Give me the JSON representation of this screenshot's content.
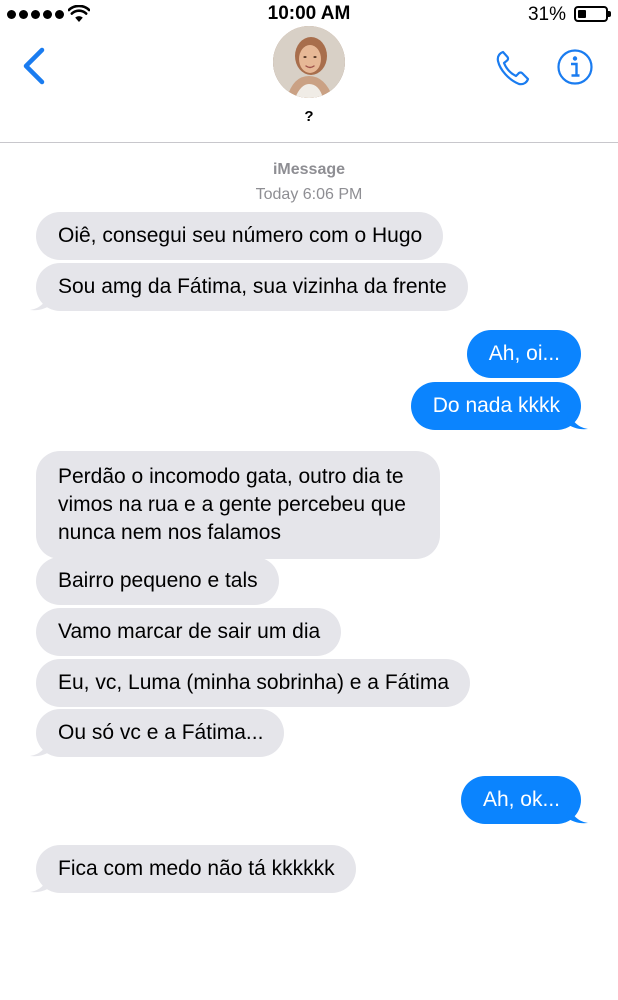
{
  "status_bar": {
    "time": "10:00 AM",
    "battery_percent": "31%",
    "battery_level": 0.31,
    "signal_bars": 5
  },
  "nav": {
    "contact_name": "?",
    "icons": [
      "back-chevron-icon",
      "avatar",
      "phone-icon",
      "info-icon"
    ],
    "accent_color": "#1a7cf0"
  },
  "thread": {
    "service": "iMessage",
    "timestamp_day": "Today",
    "timestamp_time": "6:06 PM",
    "messages": [
      {
        "from": "them",
        "text": "Oiê, consegui seu número com o Hugo"
      },
      {
        "from": "them",
        "text": "Sou amg da Fátima, sua vizinha da frente"
      },
      {
        "from": "me",
        "text": "Ah, oi..."
      },
      {
        "from": "me",
        "text": "Do nada kkkk"
      },
      {
        "from": "them",
        "text": "Perdão o incomodo gata, outro dia te vimos na rua e a gente percebeu que nunca nem nos falamos"
      },
      {
        "from": "them",
        "text": "Bairro pequeno e tals"
      },
      {
        "from": "them",
        "text": "Vamo marcar de sair um dia"
      },
      {
        "from": "them",
        "text": "Eu, vc, Luma (minha sobrinha) e a Fátima"
      },
      {
        "from": "them",
        "text": "Ou só vc e a Fátima..."
      },
      {
        "from": "me",
        "text": "Ah, ok..."
      },
      {
        "from": "them",
        "text": "Fica com medo não tá kkkkkk"
      }
    ]
  },
  "colors": {
    "incoming_bubble": "#e5e5ea",
    "outgoing_bubble": "#0b84fe",
    "meta_text": "#8e8e93"
  }
}
